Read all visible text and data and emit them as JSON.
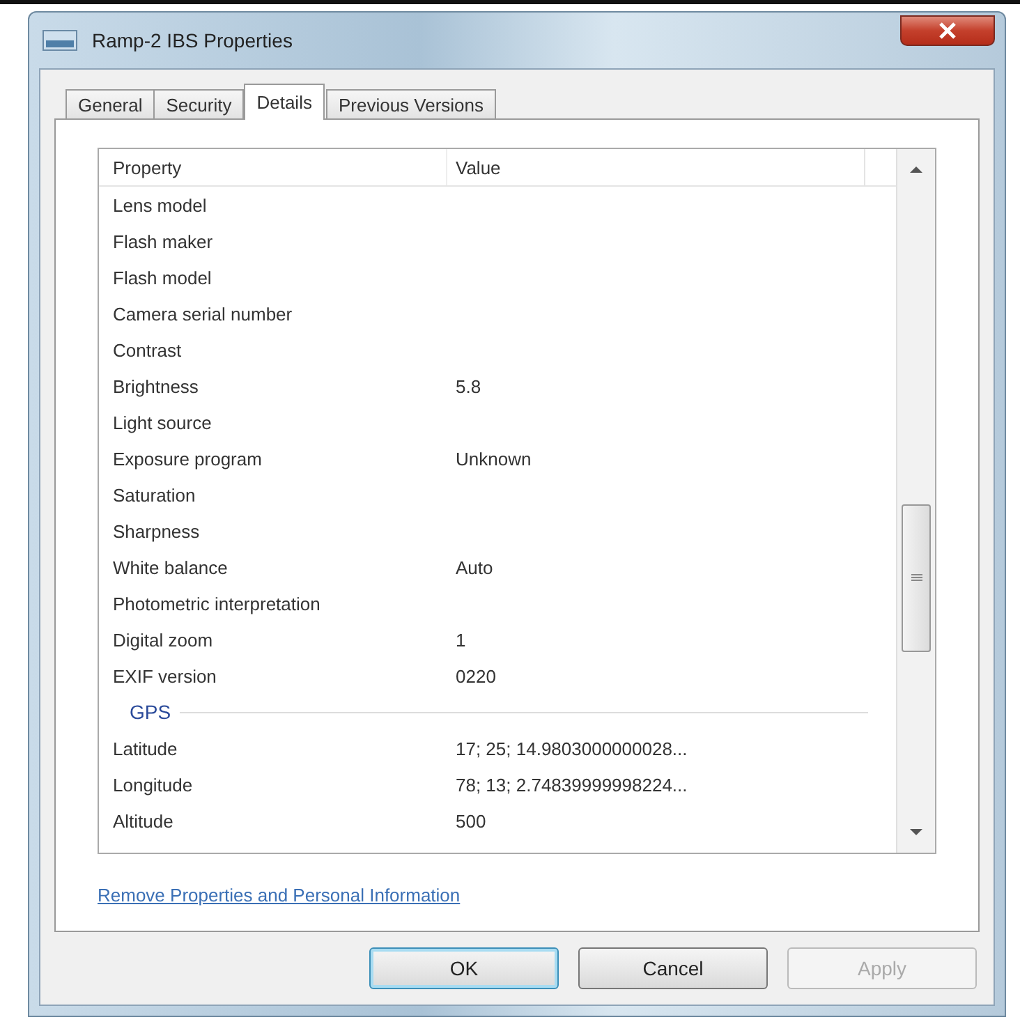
{
  "window": {
    "title": "Ramp-2 IBS Properties"
  },
  "tabs": [
    {
      "label": "General",
      "selected": false
    },
    {
      "label": "Security",
      "selected": false
    },
    {
      "label": "Details",
      "selected": true
    },
    {
      "label": "Previous Versions",
      "selected": false
    }
  ],
  "list": {
    "columns": [
      "Property",
      "Value"
    ],
    "rows": [
      {
        "kind": "row",
        "property": "Lens model"
      },
      {
        "kind": "row",
        "property": "Flash maker"
      },
      {
        "kind": "row",
        "property": "Flash model"
      },
      {
        "kind": "row",
        "property": "Camera serial number"
      },
      {
        "kind": "row",
        "property": "Contrast"
      },
      {
        "kind": "row",
        "property": "Brightness",
        "value": "5.8"
      },
      {
        "kind": "row",
        "property": "Light source"
      },
      {
        "kind": "row",
        "property": "Exposure program",
        "value": "Unknown"
      },
      {
        "kind": "row",
        "property": "Saturation"
      },
      {
        "kind": "row",
        "property": "Sharpness"
      },
      {
        "kind": "row",
        "property": "White balance",
        "value": "Auto"
      },
      {
        "kind": "row",
        "property": "Photometric interpretation"
      },
      {
        "kind": "row",
        "property": "Digital zoom",
        "value": "1"
      },
      {
        "kind": "row",
        "property": "EXIF version",
        "value": "0220"
      },
      {
        "kind": "group",
        "label": "GPS"
      },
      {
        "kind": "row",
        "property": "Latitude",
        "value": "17; 25; 14.9803000000028..."
      },
      {
        "kind": "row",
        "property": "Longitude",
        "value": "78; 13; 2.74839999998224..."
      },
      {
        "kind": "row",
        "property": "Altitude",
        "value": "500"
      }
    ]
  },
  "link": "Remove Properties and Personal Information",
  "buttons": [
    {
      "label": "OK",
      "default": true,
      "disabled": false
    },
    {
      "label": "Cancel",
      "default": false,
      "disabled": false
    },
    {
      "label": "Apply",
      "default": false,
      "disabled": true
    }
  ]
}
